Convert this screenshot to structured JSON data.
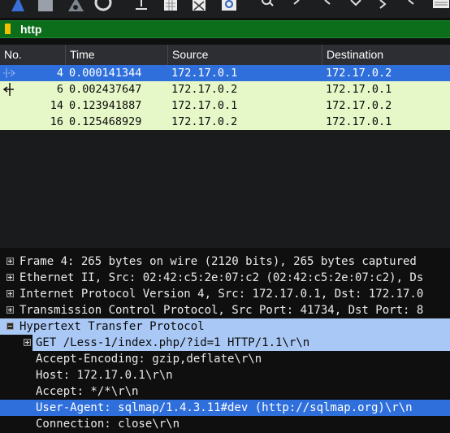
{
  "toolbar": {
    "icons": [
      "shark-fin-icon",
      "stop-icon",
      "restart-icon",
      "options-gear-icon",
      "open-file-icon",
      "save-file-icon",
      "close-file-icon",
      "reload-file-icon",
      "search-icon",
      "go-back-icon",
      "go-forward-icon",
      "go-to-packet-icon",
      "first-packet-icon",
      "last-packet-icon",
      "autoscroll-icon"
    ]
  },
  "filter": {
    "value": "http"
  },
  "packet_list": {
    "columns": [
      "No.",
      "Time",
      "Source",
      "Destination"
    ],
    "rows": [
      {
        "no": "4",
        "time": "0.000141344",
        "source": "172.17.0.1",
        "destination": "172.17.0.2",
        "selected": true
      },
      {
        "no": "6",
        "time": "0.002437647",
        "source": "172.17.0.2",
        "destination": "172.17.0.1",
        "selected": false
      },
      {
        "no": "14",
        "time": "0.123941887",
        "source": "172.17.0.1",
        "destination": "172.17.0.2",
        "selected": false
      },
      {
        "no": "16",
        "time": "0.125468929",
        "source": "172.17.0.2",
        "destination": "172.17.0.1",
        "selected": false
      }
    ]
  },
  "details": {
    "lines": [
      {
        "text": "Frame 4: 265 bytes on wire (2120 bits), 265 bytes captured"
      },
      {
        "text": "Ethernet II, Src: 02:42:c5:2e:07:c2 (02:42:c5:2e:07:c2), Ds"
      },
      {
        "text": "Internet Protocol Version 4, Src: 172.17.0.1, Dst: 172.17.0"
      },
      {
        "text": "Transmission Control Protocol, Src Port: 41734, Dst Port: 8"
      },
      {
        "text": "Hypertext Transfer Protocol"
      },
      {
        "text": "GET /Less-1/index.php/?id=1 HTTP/1.1\\r\\n"
      },
      {
        "text": "Accept-Encoding: gzip,deflate\\r\\n"
      },
      {
        "text": "Host: 172.17.0.1\\r\\n"
      },
      {
        "text": "Accept: */*\\r\\n"
      },
      {
        "text": "User-Agent: sqlmap/1.4.3.11#dev (http://sqlmap.org)\\r\\n"
      },
      {
        "text": "Connection: close\\r\\n"
      }
    ]
  },
  "colors": {
    "filter_bg": "#0c6e1b",
    "row_green": "#e6f8c8",
    "row_selected": "#2f6fdc",
    "detail_highlight": "#a9c8f5"
  }
}
